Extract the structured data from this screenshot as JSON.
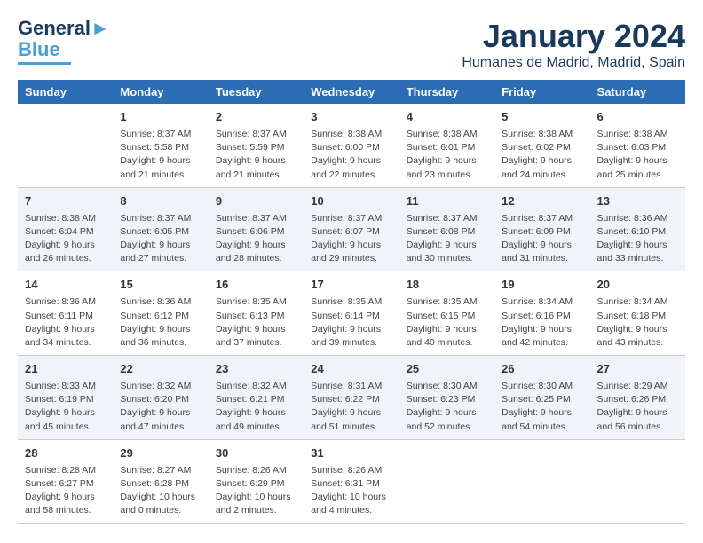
{
  "logo": {
    "line1": "General",
    "line2": "Blue"
  },
  "title": "January 2024",
  "location": "Humanes de Madrid, Madrid, Spain",
  "headers": [
    "Sunday",
    "Monday",
    "Tuesday",
    "Wednesday",
    "Thursday",
    "Friday",
    "Saturday"
  ],
  "weeks": [
    [
      {
        "day": "",
        "sunrise": "",
        "sunset": "",
        "daylight": ""
      },
      {
        "day": "1",
        "sunrise": "Sunrise: 8:37 AM",
        "sunset": "Sunset: 5:58 PM",
        "daylight": "Daylight: 9 hours and 21 minutes."
      },
      {
        "day": "2",
        "sunrise": "Sunrise: 8:37 AM",
        "sunset": "Sunset: 5:59 PM",
        "daylight": "Daylight: 9 hours and 21 minutes."
      },
      {
        "day": "3",
        "sunrise": "Sunrise: 8:38 AM",
        "sunset": "Sunset: 6:00 PM",
        "daylight": "Daylight: 9 hours and 22 minutes."
      },
      {
        "day": "4",
        "sunrise": "Sunrise: 8:38 AM",
        "sunset": "Sunset: 6:01 PM",
        "daylight": "Daylight: 9 hours and 23 minutes."
      },
      {
        "day": "5",
        "sunrise": "Sunrise: 8:38 AM",
        "sunset": "Sunset: 6:02 PM",
        "daylight": "Daylight: 9 hours and 24 minutes."
      },
      {
        "day": "6",
        "sunrise": "Sunrise: 8:38 AM",
        "sunset": "Sunset: 6:03 PM",
        "daylight": "Daylight: 9 hours and 25 minutes."
      }
    ],
    [
      {
        "day": "7",
        "sunrise": "Sunrise: 8:38 AM",
        "sunset": "Sunset: 6:04 PM",
        "daylight": "Daylight: 9 hours and 26 minutes."
      },
      {
        "day": "8",
        "sunrise": "Sunrise: 8:37 AM",
        "sunset": "Sunset: 6:05 PM",
        "daylight": "Daylight: 9 hours and 27 minutes."
      },
      {
        "day": "9",
        "sunrise": "Sunrise: 8:37 AM",
        "sunset": "Sunset: 6:06 PM",
        "daylight": "Daylight: 9 hours and 28 minutes."
      },
      {
        "day": "10",
        "sunrise": "Sunrise: 8:37 AM",
        "sunset": "Sunset: 6:07 PM",
        "daylight": "Daylight: 9 hours and 29 minutes."
      },
      {
        "day": "11",
        "sunrise": "Sunrise: 8:37 AM",
        "sunset": "Sunset: 6:08 PM",
        "daylight": "Daylight: 9 hours and 30 minutes."
      },
      {
        "day": "12",
        "sunrise": "Sunrise: 8:37 AM",
        "sunset": "Sunset: 6:09 PM",
        "daylight": "Daylight: 9 hours and 31 minutes."
      },
      {
        "day": "13",
        "sunrise": "Sunrise: 8:36 AM",
        "sunset": "Sunset: 6:10 PM",
        "daylight": "Daylight: 9 hours and 33 minutes."
      }
    ],
    [
      {
        "day": "14",
        "sunrise": "Sunrise: 8:36 AM",
        "sunset": "Sunset: 6:11 PM",
        "daylight": "Daylight: 9 hours and 34 minutes."
      },
      {
        "day": "15",
        "sunrise": "Sunrise: 8:36 AM",
        "sunset": "Sunset: 6:12 PM",
        "daylight": "Daylight: 9 hours and 36 minutes."
      },
      {
        "day": "16",
        "sunrise": "Sunrise: 8:35 AM",
        "sunset": "Sunset: 6:13 PM",
        "daylight": "Daylight: 9 hours and 37 minutes."
      },
      {
        "day": "17",
        "sunrise": "Sunrise: 8:35 AM",
        "sunset": "Sunset: 6:14 PM",
        "daylight": "Daylight: 9 hours and 39 minutes."
      },
      {
        "day": "18",
        "sunrise": "Sunrise: 8:35 AM",
        "sunset": "Sunset: 6:15 PM",
        "daylight": "Daylight: 9 hours and 40 minutes."
      },
      {
        "day": "19",
        "sunrise": "Sunrise: 8:34 AM",
        "sunset": "Sunset: 6:16 PM",
        "daylight": "Daylight: 9 hours and 42 minutes."
      },
      {
        "day": "20",
        "sunrise": "Sunrise: 8:34 AM",
        "sunset": "Sunset: 6:18 PM",
        "daylight": "Daylight: 9 hours and 43 minutes."
      }
    ],
    [
      {
        "day": "21",
        "sunrise": "Sunrise: 8:33 AM",
        "sunset": "Sunset: 6:19 PM",
        "daylight": "Daylight: 9 hours and 45 minutes."
      },
      {
        "day": "22",
        "sunrise": "Sunrise: 8:32 AM",
        "sunset": "Sunset: 6:20 PM",
        "daylight": "Daylight: 9 hours and 47 minutes."
      },
      {
        "day": "23",
        "sunrise": "Sunrise: 8:32 AM",
        "sunset": "Sunset: 6:21 PM",
        "daylight": "Daylight: 9 hours and 49 minutes."
      },
      {
        "day": "24",
        "sunrise": "Sunrise: 8:31 AM",
        "sunset": "Sunset: 6:22 PM",
        "daylight": "Daylight: 9 hours and 51 minutes."
      },
      {
        "day": "25",
        "sunrise": "Sunrise: 8:30 AM",
        "sunset": "Sunset: 6:23 PM",
        "daylight": "Daylight: 9 hours and 52 minutes."
      },
      {
        "day": "26",
        "sunrise": "Sunrise: 8:30 AM",
        "sunset": "Sunset: 6:25 PM",
        "daylight": "Daylight: 9 hours and 54 minutes."
      },
      {
        "day": "27",
        "sunrise": "Sunrise: 8:29 AM",
        "sunset": "Sunset: 6:26 PM",
        "daylight": "Daylight: 9 hours and 56 minutes."
      }
    ],
    [
      {
        "day": "28",
        "sunrise": "Sunrise: 8:28 AM",
        "sunset": "Sunset: 6:27 PM",
        "daylight": "Daylight: 9 hours and 58 minutes."
      },
      {
        "day": "29",
        "sunrise": "Sunrise: 8:27 AM",
        "sunset": "Sunset: 6:28 PM",
        "daylight": "Daylight: 10 hours and 0 minutes."
      },
      {
        "day": "30",
        "sunrise": "Sunrise: 8:26 AM",
        "sunset": "Sunset: 6:29 PM",
        "daylight": "Daylight: 10 hours and 2 minutes."
      },
      {
        "day": "31",
        "sunrise": "Sunrise: 8:26 AM",
        "sunset": "Sunset: 6:31 PM",
        "daylight": "Daylight: 10 hours and 4 minutes."
      },
      {
        "day": "",
        "sunrise": "",
        "sunset": "",
        "daylight": ""
      },
      {
        "day": "",
        "sunrise": "",
        "sunset": "",
        "daylight": ""
      },
      {
        "day": "",
        "sunrise": "",
        "sunset": "",
        "daylight": ""
      }
    ]
  ]
}
